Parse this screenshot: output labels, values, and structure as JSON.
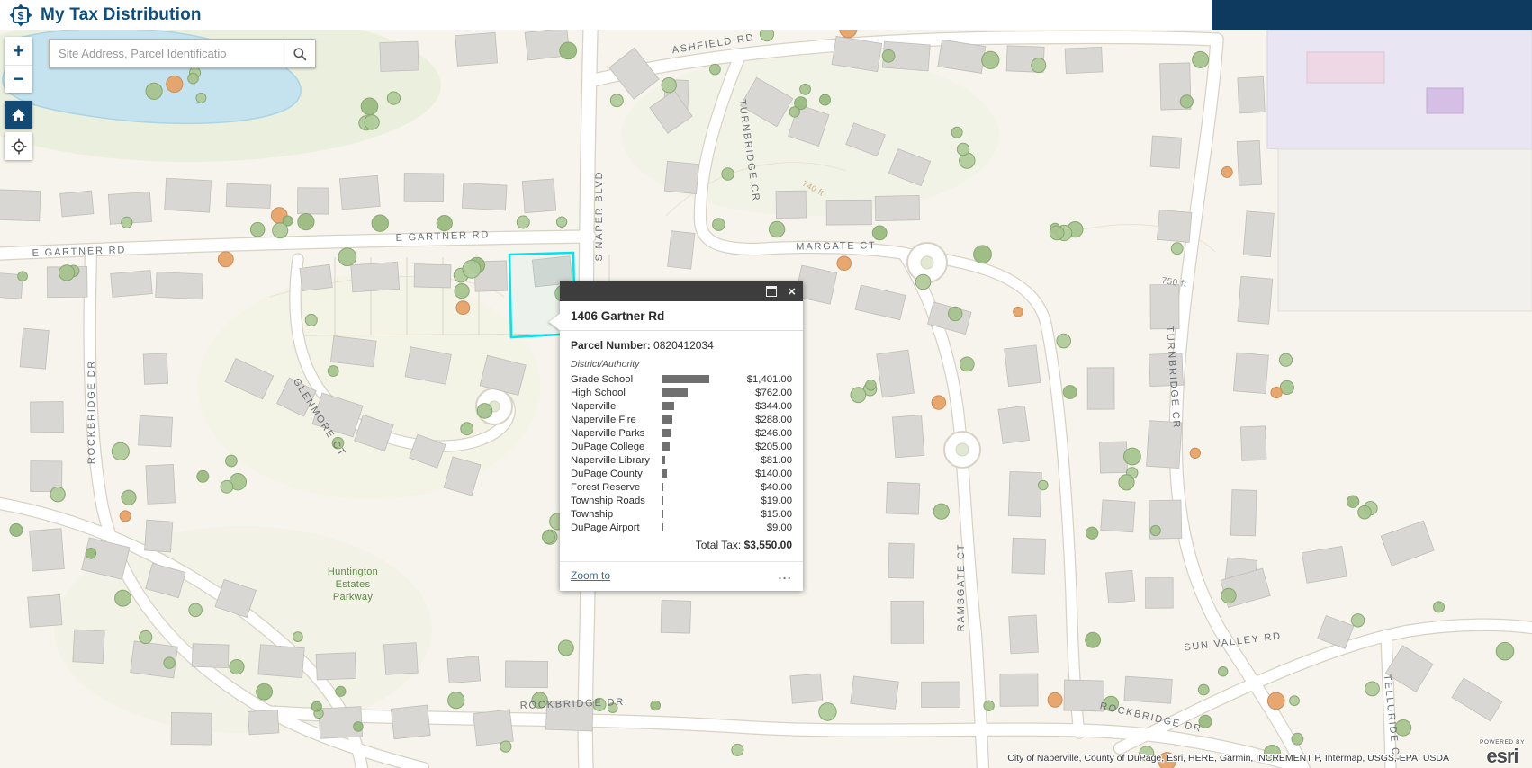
{
  "header": {
    "title": "My Tax Distribution"
  },
  "search": {
    "placeholder": "Site Address, Parcel Identificatio"
  },
  "controls": {
    "zoom_in": "+",
    "zoom_out": "−"
  },
  "popup": {
    "title": "1406 Gartner Rd",
    "parcel_number_label": "Parcel Number:",
    "parcel_number": "0820412034",
    "section_label": "District/Authority",
    "max_bar_value": 1401,
    "tax_rows": [
      {
        "label": "Grade School",
        "value": 1401,
        "amount": "$1,401.00"
      },
      {
        "label": "High School",
        "value": 762,
        "amount": "$762.00"
      },
      {
        "label": "Naperville",
        "value": 344,
        "amount": "$344.00"
      },
      {
        "label": "Naperville Fire",
        "value": 288,
        "amount": "$288.00"
      },
      {
        "label": "Naperville Parks",
        "value": 246,
        "amount": "$246.00"
      },
      {
        "label": "DuPage College",
        "value": 205,
        "amount": "$205.00"
      },
      {
        "label": "Naperville Library",
        "value": 81,
        "amount": "$81.00"
      },
      {
        "label": "DuPage County",
        "value": 140,
        "amount": "$140.00"
      },
      {
        "label": "Forest Reserve",
        "value": 40,
        "amount": "$40.00"
      },
      {
        "label": "Township Roads",
        "value": 19,
        "amount": "$19.00"
      },
      {
        "label": "Township",
        "value": 15,
        "amount": "$15.00"
      },
      {
        "label": "DuPage Airport",
        "value": 9,
        "amount": "$9.00"
      }
    ],
    "total_label": "Total Tax:",
    "total_amount": "$3,550.00",
    "zoom_to_label": "Zoom to",
    "more_label": "..."
  },
  "chart_data": {
    "type": "bar",
    "title": "District/Authority",
    "categories": [
      "Grade School",
      "High School",
      "Naperville",
      "Naperville Fire",
      "Naperville Parks",
      "DuPage College",
      "Naperville Library",
      "DuPage County",
      "Forest Reserve",
      "Township Roads",
      "Township",
      "DuPage Airport"
    ],
    "values": [
      1401,
      762,
      344,
      288,
      246,
      205,
      81,
      140,
      40,
      19,
      15,
      9
    ],
    "total_label": "Total Tax:",
    "total": 3550
  },
  "map": {
    "labels": {
      "ashfield": "ASHFIELD RD",
      "gartner": "E GARTNER RD",
      "naper": "S NAPER BLVD",
      "turnbridge": "TURNBRIDGE CR",
      "margate": "MARGATE CT",
      "rockbridge": "ROCKBRIDGE DR",
      "glenmore": "GLENMORE CT",
      "ramsgate": "RAMSGATE CT",
      "sun_valley": "SUN VALLEY RD",
      "telluride": "TELLURIDE CT",
      "huntington_line1": "Huntington",
      "huntington_line2": "Estates",
      "huntington_line3": "Parkway",
      "scale_750": "750 ft",
      "contour_740": "740 ft"
    },
    "highlight_color": "#00e4f0"
  },
  "attribution": {
    "text": "City of Naperville, County of DuPage, Esri, HERE, Garmin, INCREMENT P, Intermap, USGS, EPA, USDA",
    "powered_by": "POWERED BY",
    "esri": "esri"
  }
}
